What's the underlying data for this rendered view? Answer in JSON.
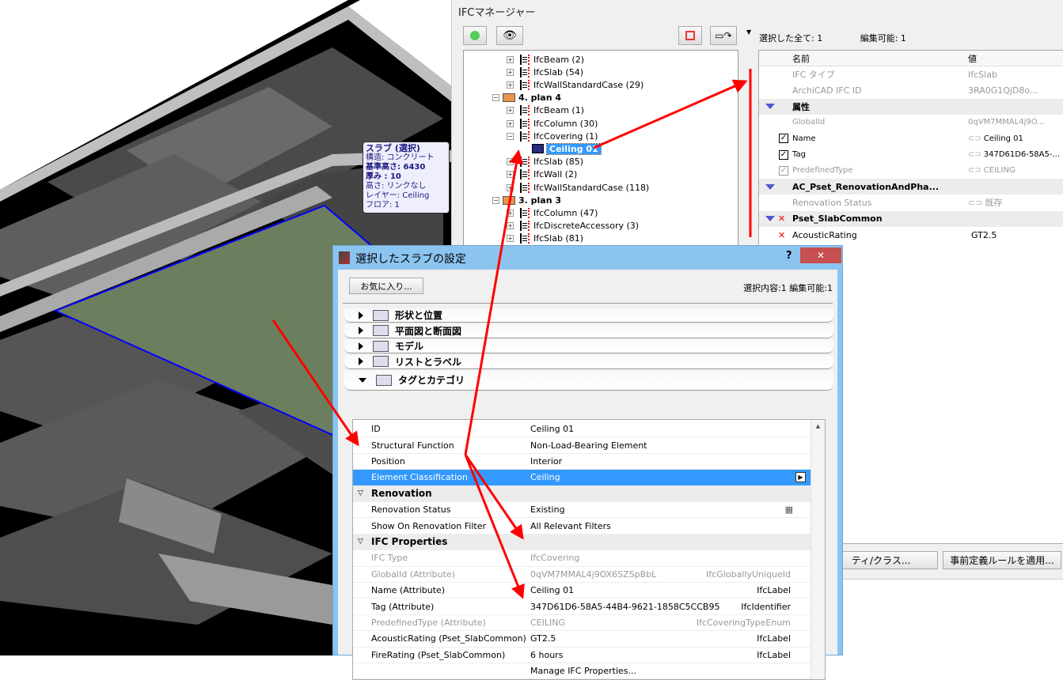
{
  "viewport_tooltip": {
    "title": "スラブ (選択)",
    "lines": [
      "構造: コンクリート",
      "基準高さ: 6430",
      "厚み : 10",
      "高さ: リンクなし",
      "レイヤー: Ceiling",
      "フロア: 1"
    ]
  },
  "ifc_manager": {
    "title": "IFCマネージャー",
    "toolbar": {
      "refresh": "refresh-icon",
      "filter": "filter-eye-icon",
      "select": "select-polygon-icon",
      "transfer": "transfer-selection-icon"
    },
    "tree": [
      {
        "label": "IfcBeam (2)",
        "level": 2,
        "expand": "+"
      },
      {
        "label": "IfcSlab (54)",
        "level": 2,
        "expand": "+"
      },
      {
        "label": "IfcWallStandardCase (29)",
        "level": 2,
        "expand": "+"
      },
      {
        "label": "4. plan 4",
        "level": 1,
        "expand": "-",
        "storey": true
      },
      {
        "label": "IfcBeam (1)",
        "level": 2,
        "expand": "+"
      },
      {
        "label": "IfcColumn (30)",
        "level": 2,
        "expand": "+"
      },
      {
        "label": "IfcCovering (1)",
        "level": 2,
        "expand": "-"
      },
      {
        "label": "Ceiling 01",
        "level": 3,
        "selected": true
      },
      {
        "label": "IfcSlab (85)",
        "level": 2,
        "expand": "+"
      },
      {
        "label": "IfcWall (2)",
        "level": 2,
        "expand": "+"
      },
      {
        "label": "IfcWallStandardCase (118)",
        "level": 2,
        "expand": "+"
      },
      {
        "label": "3. plan 3",
        "level": 1,
        "expand": "-",
        "storey": true
      },
      {
        "label": "IfcColumn (47)",
        "level": 2,
        "expand": "+"
      },
      {
        "label": "IfcDiscreteAccessory (3)",
        "level": 2,
        "expand": "+"
      },
      {
        "label": "IfcSlab (81)",
        "level": 2,
        "expand": "+"
      }
    ],
    "selected_all": "選択した全て: 1",
    "editable": "編集可能: 1",
    "props_header": {
      "name": "名前",
      "value": "値"
    },
    "props": [
      {
        "name": "IFC タイプ",
        "value": "IfcSlab",
        "style": "grey"
      },
      {
        "name": "ArchiCAD IFC ID",
        "value": "3RA0G1QjD8o...",
        "style": "grey"
      },
      {
        "name": "属性",
        "style": "group"
      },
      {
        "name": "GlobalId",
        "value": "0qVM7MMAL4j9O...",
        "style": "grey-small"
      },
      {
        "name": "Name",
        "value": "Ceiling 01",
        "check": "checked",
        "link": true
      },
      {
        "name": "Tag",
        "value": "347D61D6-58A5-...",
        "check": "checked",
        "link": true
      },
      {
        "name": "PredefinedType",
        "value": "CEILING",
        "check": "checked-grey",
        "link": true,
        "style": "grey-small"
      },
      {
        "name": "AC_Pset_RenovationAndPha...",
        "style": "group"
      },
      {
        "name": "Renovation Status",
        "value": "既存",
        "style": "grey",
        "link": true
      },
      {
        "name": "Pset_SlabCommon",
        "style": "group",
        "x": true
      },
      {
        "name": "AcousticRating",
        "value": "GT2.5",
        "x": true
      }
    ],
    "buttons": {
      "property_class": "ティ/クラス...",
      "apply_rules": "事前定義ルールを適用..."
    }
  },
  "dialog": {
    "title": "選択したスラブの設定",
    "help": "?",
    "close": "✕",
    "favorites": "お気に入り...",
    "selection_info": "選択内容:1 編集可能:1",
    "panels": [
      {
        "label": "形状と位置",
        "open": false,
        "icon": "geometry-icon"
      },
      {
        "label": "平面図と断面図",
        "open": false,
        "icon": "floor-plan-icon"
      },
      {
        "label": "モデル",
        "open": false,
        "icon": "model-icon"
      },
      {
        "label": "リストとラベル",
        "open": false,
        "icon": "list-label-icon"
      },
      {
        "label": "タグとカテゴリ",
        "open": true,
        "icon": "tags-categories-icon"
      }
    ],
    "rows": [
      {
        "name": "ID",
        "value": "Ceiling 01"
      },
      {
        "name": "Structural Function",
        "value": "Non-Load-Bearing Element"
      },
      {
        "name": "Position",
        "value": "Interior"
      },
      {
        "name": "Element Classification",
        "value": "Ceiling",
        "selected": true
      },
      {
        "name": "Renovation",
        "group": true
      },
      {
        "name": "Renovation Status",
        "value": "Existing"
      },
      {
        "name": "Show On Renovation Filter",
        "value": "All Relevant Filters"
      },
      {
        "name": "IFC Properties",
        "group": true
      },
      {
        "name": "IFC Type",
        "value": "IfcCovering",
        "grey": true
      },
      {
        "name": "GlobalId (Attribute)",
        "value": "0qVM7MMAL4j9OX6SZSpBbL",
        "type": "IfcGloballyUniqueId",
        "grey": true
      },
      {
        "name": "Name (Attribute)",
        "value": "Ceiling 01",
        "type": "IfcLabel"
      },
      {
        "name": "Tag (Attribute)",
        "value": "347D61D6-58A5-44B4-9621-1858C5CCB95",
        "type": "IfcIdentifier"
      },
      {
        "name": "PredefinedType (Attribute)",
        "value": "CEILING",
        "type": "IfcCoveringTypeEnum",
        "grey": true
      },
      {
        "name": "AcousticRating (Pset_SlabCommon)",
        "value": "GT2.5",
        "type": "IfcLabel"
      },
      {
        "name": "FireRating (Pset_SlabCommon)",
        "value": "6 hours",
        "type": "IfcLabel"
      },
      {
        "name": "",
        "value": "Manage IFC Properties..."
      }
    ]
  },
  "colors": {
    "annotation_arrow": "#ff0000",
    "selection": "#3399ff",
    "dialog_frame": "#8cc4f0",
    "close_button": "#c75050",
    "selected_slab_outline": "#0000ff"
  }
}
